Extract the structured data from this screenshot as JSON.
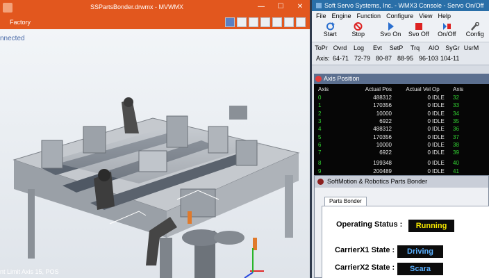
{
  "left_window": {
    "title": "SSPartsBonder.drwmx - MVWMX",
    "menu": "Factory",
    "connection_text": "nnected",
    "status_text": "nt Limit Axis 15, POS"
  },
  "right_window": {
    "title": "Soft Servo Systems, Inc. - WMX3 Console - Servo On/Off",
    "menu": [
      "File",
      "Engine",
      "Function",
      "Configure",
      "View",
      "Help"
    ],
    "tools": [
      {
        "label": "Start",
        "icon": "refresh-icon"
      },
      {
        "label": "Stop",
        "icon": "stop-sign-icon"
      },
      {
        "label": "Svo On",
        "icon": "servo-on-icon"
      },
      {
        "label": "Svo Off",
        "icon": "servo-off-icon"
      },
      {
        "label": "On/Off",
        "icon": "toggle-icon"
      },
      {
        "label": "Config",
        "icon": "wrench-icon"
      }
    ],
    "tabs": [
      "ToPr",
      "Ovrd",
      "Log",
      "Evt",
      "SetP",
      "Trq",
      "AIO",
      "SyGr",
      "UsrM"
    ],
    "axis_bar": {
      "label": "Axis:",
      "ranges": [
        "64-71",
        "72-79",
        "80-87",
        "88-95",
        "96-103",
        "104-11"
      ]
    }
  },
  "axis_position": {
    "title": "Axis Position",
    "headers": {
      "axis": "Axis",
      "pos": "Actual Pos",
      "vel": "Actual Vel",
      "op": "Op",
      "axis2": "Axis"
    },
    "rows": [
      {
        "axis": "0",
        "pos": "488312",
        "vel": "0",
        "op": "IDLE",
        "axis2": "32"
      },
      {
        "axis": "1",
        "pos": "170356",
        "vel": "0",
        "op": "IDLE",
        "axis2": "33"
      },
      {
        "axis": "2",
        "pos": "10000",
        "vel": "0",
        "op": "IDLE",
        "axis2": "34"
      },
      {
        "axis": "3",
        "pos": "6922",
        "vel": "0",
        "op": "IDLE",
        "axis2": "35"
      },
      {
        "axis": "4",
        "pos": "488312",
        "vel": "0",
        "op": "IDLE",
        "axis2": "36"
      },
      {
        "axis": "5",
        "pos": "170356",
        "vel": "0",
        "op": "IDLE",
        "axis2": "37"
      },
      {
        "axis": "6",
        "pos": "10000",
        "vel": "0",
        "op": "IDLE",
        "axis2": "38"
      },
      {
        "axis": "7",
        "pos": "6922",
        "vel": "0",
        "op": "IDLE",
        "axis2": "39"
      },
      {
        "axis": "8",
        "pos": "199348",
        "vel": "0",
        "op": "IDLE",
        "axis2": "40"
      },
      {
        "axis": "9",
        "pos": "200489",
        "vel": "0",
        "op": "IDLE",
        "axis2": "41"
      }
    ]
  },
  "softmotion": {
    "title": "SoftMotion & Robotics Parts Bonder",
    "tab": "Parts Bonder",
    "operating_status_label": "Operating Status :",
    "operating_status_value": "Running",
    "carrier1_label": "CarrierX1 State :",
    "carrier1_value": "Driving",
    "carrier2_label": "CarrierX2 State :",
    "carrier2_value": "Scara",
    "colors": {
      "running": "#f5e700",
      "driving": "#5ab0ff",
      "scara": "#5ab0ff"
    }
  }
}
